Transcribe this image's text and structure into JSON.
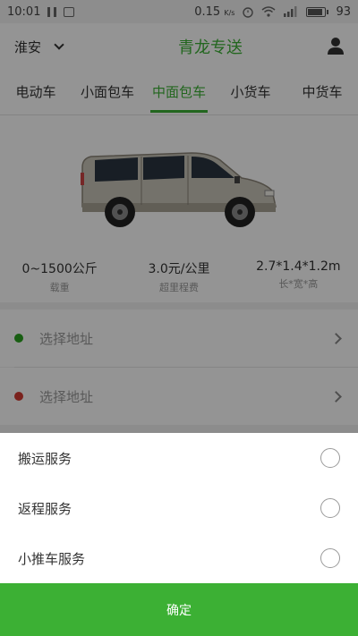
{
  "status_bar": {
    "time": "10:01",
    "speed": "0.15",
    "speed_unit": "K/s",
    "battery": "93"
  },
  "header": {
    "city": "淮安",
    "title": "青龙专送"
  },
  "tabs": [
    {
      "label": "电动车"
    },
    {
      "label": "小面包车"
    },
    {
      "label": "中面包车",
      "active": true
    },
    {
      "label": "小货车"
    },
    {
      "label": "中货车"
    }
  ],
  "specs": [
    {
      "value": "0~1500公斤",
      "label": "载重"
    },
    {
      "value": "3.0元/公里",
      "label": "超里程费"
    },
    {
      "value": "2.7*1.4*1.2m",
      "label": "长*宽*高"
    }
  ],
  "addresses": [
    {
      "placeholder": "选择地址",
      "dot_color": "#2aa31f"
    },
    {
      "placeholder": "选择地址",
      "dot_color": "#d23b32"
    }
  ],
  "services": [
    {
      "label": "搬运服务"
    },
    {
      "label": "返程服务"
    },
    {
      "label": "小推车服务"
    }
  ],
  "confirm_label": "确定",
  "colors": {
    "accent": "#3cb034"
  }
}
